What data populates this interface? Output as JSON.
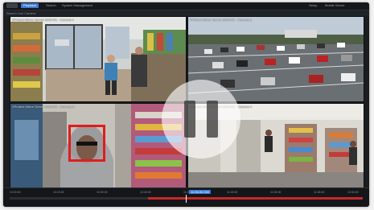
{
  "app": {
    "tabs": [
      {
        "label": "Playback",
        "active": true
      },
      {
        "label": "Search",
        "active": false
      },
      {
        "label": "System Management",
        "active": false
      }
    ],
    "top_right": [
      "Setup",
      "Mobile Server"
    ],
    "subtitle": "Search Live Camera"
  },
  "cameras": [
    {
      "label": "XProtect Mirror Server 2019 R1 - Camera 1"
    },
    {
      "label": "XProtect Mirror Server 2019 R1 - Camera 2"
    },
    {
      "label": "XProtect Mirror Server 2019 R1 - Camera 3"
    },
    {
      "label": "XProtect Mirror Server 2019 R1 - Camera 4"
    }
  ],
  "timeline": {
    "ticks": [
      "10:00:00",
      "10:15:00",
      "10:30:00",
      "10:45:00",
      "11:00:00",
      "11:15:00",
      "11:30:00",
      "11:45:00",
      "12:00:00"
    ],
    "current_time": "11:06:00.000",
    "accent": "#3a7bd5",
    "recording_color": "#c62828"
  },
  "overlay": {
    "icon": "pause-icon"
  },
  "detection": {
    "color": "#e21c1c"
  }
}
